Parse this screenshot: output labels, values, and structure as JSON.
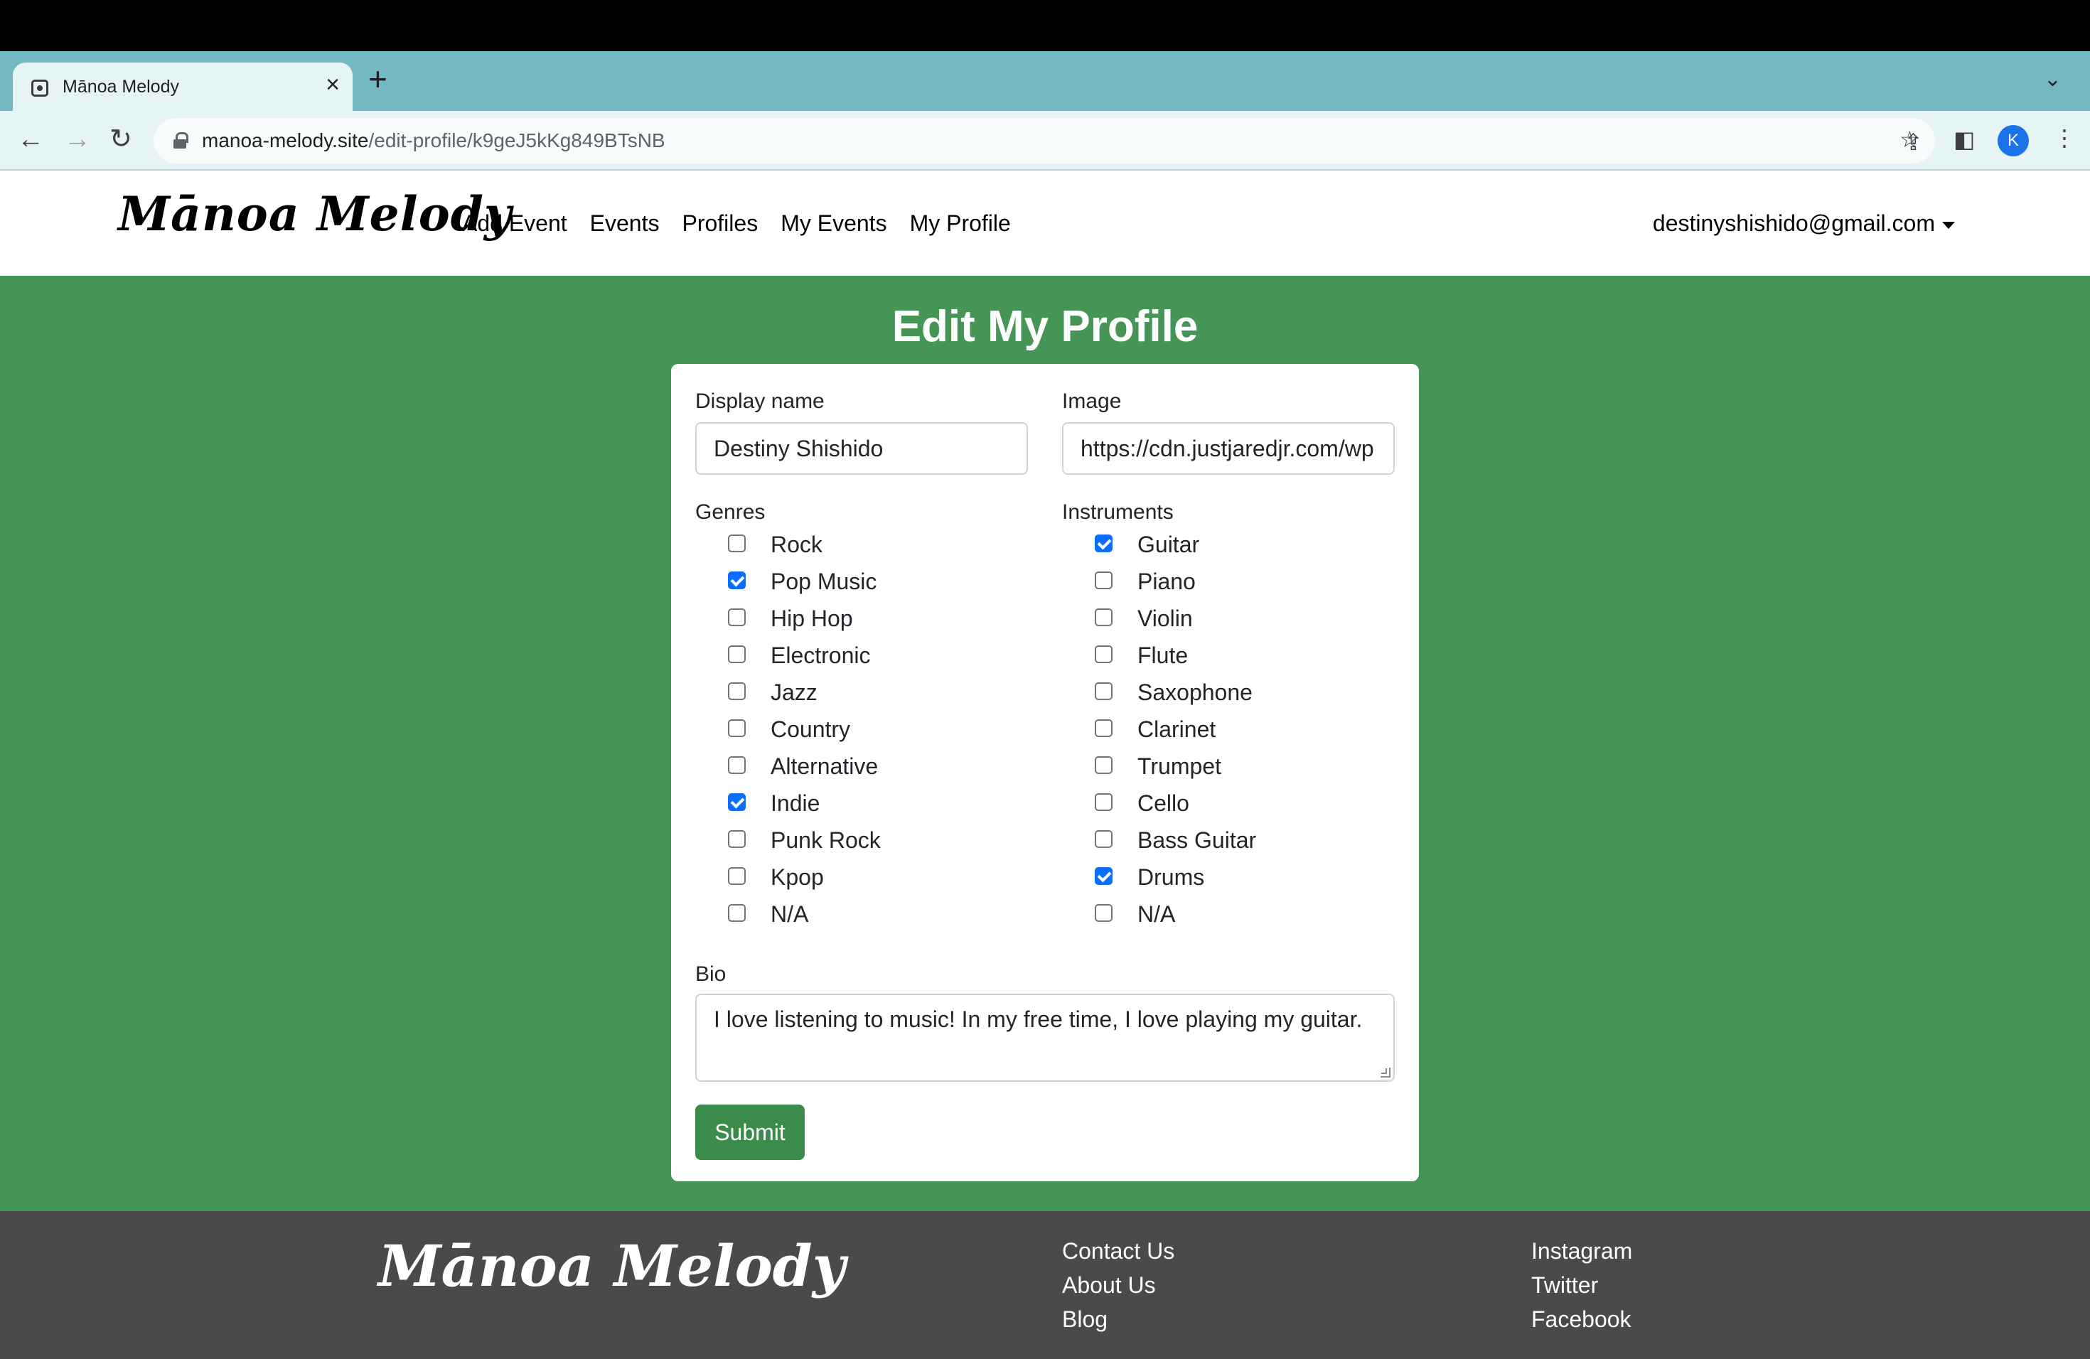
{
  "browser": {
    "tab_title": "Mānoa Melody",
    "url_host": "manoa-melody.site",
    "url_path": "/edit-profile/k9geJ5kKg849BTsNB",
    "avatar_letter": "K"
  },
  "navbar": {
    "brand": "Mānoa Melody",
    "links": [
      "Add Event",
      "Events",
      "Profiles",
      "My Events",
      "My Profile"
    ],
    "user_email": "destinyshishido@gmail.com"
  },
  "page": {
    "title": "Edit My Profile"
  },
  "form": {
    "display_name_label": "Display name",
    "display_name_value": "Destiny Shishido",
    "image_label": "Image",
    "image_value": "https://cdn.justjaredjr.com/wp",
    "genres_label": "Genres",
    "genres": [
      {
        "label": "Rock",
        "checked": false
      },
      {
        "label": "Pop Music",
        "checked": true
      },
      {
        "label": "Hip Hop",
        "checked": false
      },
      {
        "label": "Electronic",
        "checked": false
      },
      {
        "label": "Jazz",
        "checked": false
      },
      {
        "label": "Country",
        "checked": false
      },
      {
        "label": "Alternative",
        "checked": false
      },
      {
        "label": "Indie",
        "checked": true
      },
      {
        "label": "Punk Rock",
        "checked": false
      },
      {
        "label": "Kpop",
        "checked": false
      },
      {
        "label": "N/A",
        "checked": false
      }
    ],
    "instruments_label": "Instruments",
    "instruments": [
      {
        "label": "Guitar",
        "checked": true
      },
      {
        "label": "Piano",
        "checked": false
      },
      {
        "label": "Violin",
        "checked": false
      },
      {
        "label": "Flute",
        "checked": false
      },
      {
        "label": "Saxophone",
        "checked": false
      },
      {
        "label": "Clarinet",
        "checked": false
      },
      {
        "label": "Trumpet",
        "checked": false
      },
      {
        "label": "Cello",
        "checked": false
      },
      {
        "label": "Bass Guitar",
        "checked": false
      },
      {
        "label": "Drums",
        "checked": true
      },
      {
        "label": "N/A",
        "checked": false
      }
    ],
    "bio_label": "Bio",
    "bio_value": "I love listening to music! In my free time, I love playing my guitar.",
    "submit_label": "Submit"
  },
  "footer": {
    "brand": "Mānoa Melody",
    "col1": [
      "Contact Us",
      "About Us",
      "Blog"
    ],
    "col2": [
      "Instagram",
      "Twitter",
      "Facebook"
    ]
  },
  "colors": {
    "main_bg": "#459556",
    "submit_bg": "#3b8b4b",
    "footer_bg": "#4a4a4a",
    "checkbox_checked": "#0d6efd",
    "tabstrip_bg": "#74b9c1"
  }
}
